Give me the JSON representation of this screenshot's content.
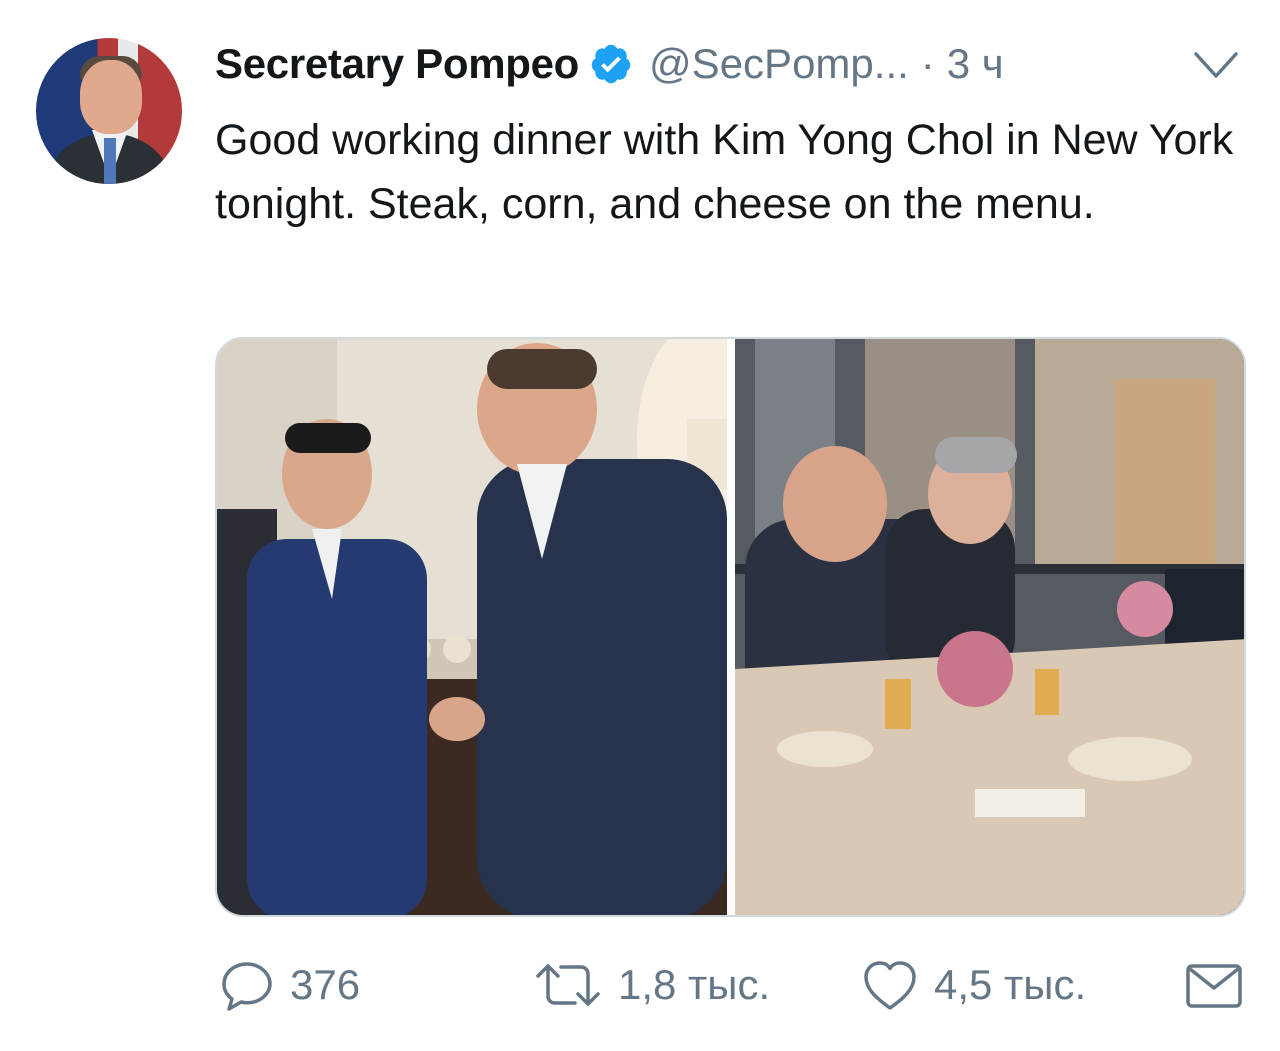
{
  "tweet": {
    "author_name": "Secretary Pompeo",
    "handle": "@SecPomp...",
    "separator": "·",
    "time": "3 ч",
    "text": "Good working dinner with Kim Yong Chol in New York tonight. Steak, corn, and cheese on the menu."
  },
  "media": {
    "photos": [
      "handshake-photo",
      "dinner-table-photo"
    ]
  },
  "actions": {
    "reply_count": "376",
    "retweet_count": "1,8 тыс.",
    "like_count": "4,5 тыс."
  },
  "icons": {
    "verified": "verified-badge-icon",
    "menu": "chevron-down-icon",
    "reply": "reply-icon",
    "retweet": "retweet-icon",
    "like": "heart-icon",
    "dm": "envelope-icon"
  },
  "colors": {
    "verified": "#1da1f2",
    "muted": "#657786",
    "text": "#14171a"
  }
}
